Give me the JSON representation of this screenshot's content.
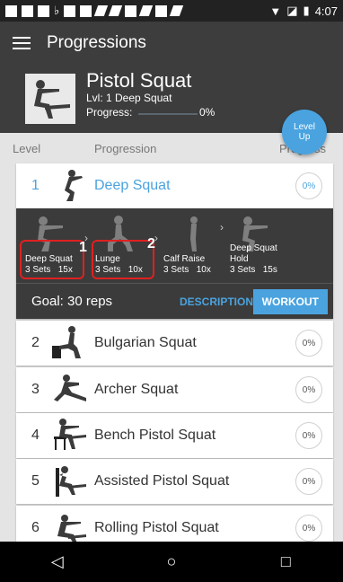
{
  "status_bar": {
    "time": "4:07",
    "notification_icons": [
      "chat-icon",
      "flipboard-icon",
      "file-icon",
      "notification-icon"
    ],
    "system_icons": [
      "wifi-icon",
      "signal-icon",
      "battery-icon"
    ]
  },
  "app_bar": {
    "title": "Progressions",
    "menu_icon": "hamburger-menu-icon"
  },
  "exercise": {
    "name": "Pistol Squat",
    "level_text": "Lvl: 1 Deep Squat",
    "progress_label": "Progress:",
    "progress_percent": "0%",
    "progress_value": 0
  },
  "level_up": {
    "line1": "Level",
    "line2": "Up"
  },
  "columns": {
    "level": "Level",
    "progression": "Progression",
    "progress": "Progress"
  },
  "progressions": [
    {
      "level": "1",
      "name": "Deep Squat",
      "progress": "0%"
    },
    {
      "level": "2",
      "name": "Bulgarian Squat",
      "progress": "0%"
    },
    {
      "level": "3",
      "name": "Archer Squat",
      "progress": "0%"
    },
    {
      "level": "4",
      "name": "Bench Pistol Squat",
      "progress": "0%"
    },
    {
      "level": "5",
      "name": "Assisted Pistol Squat",
      "progress": "0%"
    },
    {
      "level": "6",
      "name": "Rolling Pistol Squat",
      "progress": "0%"
    }
  ],
  "workout_steps": [
    {
      "name": "Deep Squat",
      "sets": "3 Sets",
      "reps": "15x"
    },
    {
      "name": "Lunge",
      "sets": "3 Sets",
      "reps": "10x"
    },
    {
      "name": "Calf Raise",
      "sets": "3 Sets",
      "reps": "10x"
    },
    {
      "name": "Deep Squat",
      "name2": "Hold",
      "sets": "3 Sets",
      "reps": "15s"
    }
  ],
  "annotations": [
    "1",
    "2"
  ],
  "goal": {
    "text": "Goal: 30 reps",
    "description_button": "DESCRIPTION",
    "workout_button": "WORKOUT"
  },
  "nav_bar": {
    "back": "◁",
    "home": "○",
    "recents": "□"
  },
  "colors": {
    "accent": "#4aa3df",
    "header_bg": "#3d3d3d",
    "highlight_box": "#e02020"
  }
}
